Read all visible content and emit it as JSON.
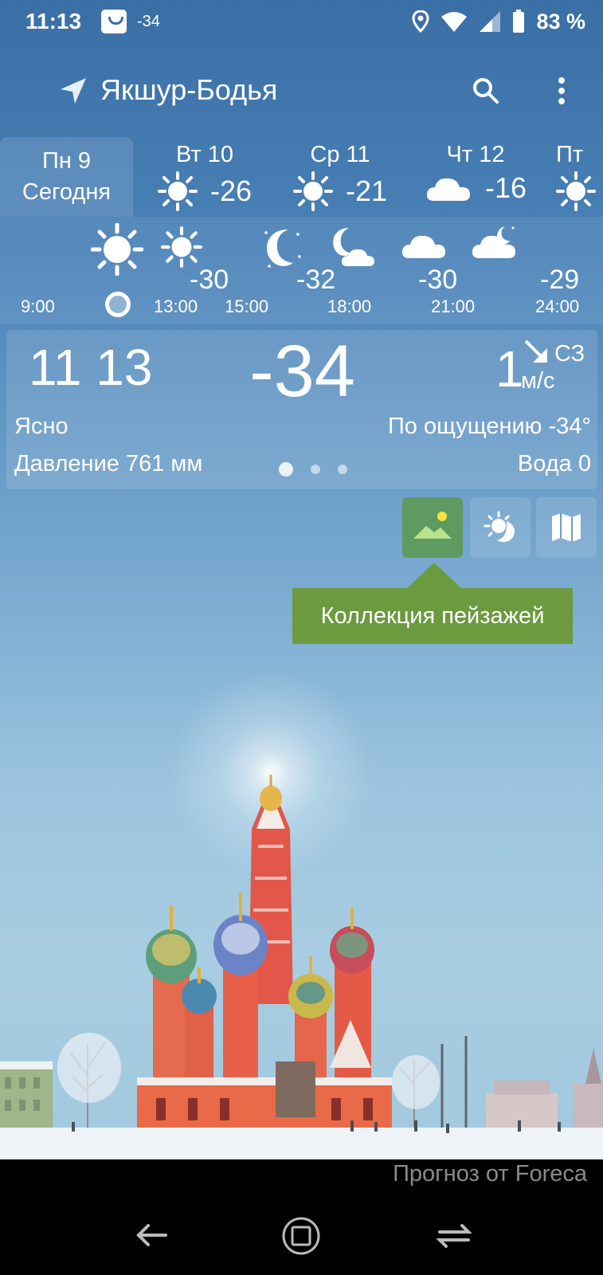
{
  "status_bar": {
    "time": "11:13",
    "notif_temp": "-34",
    "battery_text": "83 %"
  },
  "header": {
    "city": "Якшур-Бодья"
  },
  "days": [
    {
      "name": "Пн 9",
      "label": "Сегодня",
      "selected": true
    },
    {
      "name": "Вт 10",
      "temp": "-26",
      "icon": "sun-icon"
    },
    {
      "name": "Ср 11",
      "temp": "-21",
      "icon": "sun-icon"
    },
    {
      "name": "Чт 12",
      "temp": "-16",
      "icon": "cloud-icon"
    },
    {
      "name": "Пт",
      "icon": "sun-icon"
    }
  ],
  "hourly": {
    "icons": [
      "sun-icon",
      "sun-icon",
      "moon-icon",
      "moon-cloud-icon",
      "cloud-icon",
      "moon-cloud-icon"
    ],
    "temps": [
      "-30",
      "-32",
      "-30",
      "-29"
    ],
    "times": [
      "9:00",
      "13:00",
      "15:00",
      "18:00",
      "21:00",
      "24:00"
    ]
  },
  "current": {
    "time": "11 13",
    "temp": "-34",
    "wind_speed": "1",
    "wind_dir": "СЗ",
    "wind_unit": "м/с",
    "condition": "Ясно",
    "feels_like": "По ощущению -34°",
    "pressure": "Давление 761 мм",
    "water": "Вода 0"
  },
  "view_buttons": [
    "landscape-icon",
    "sun-moon-icon",
    "map-icon"
  ],
  "tooltip": "Коллекция пейзажей",
  "credit": "Прогноз от Foreca",
  "colors": {
    "tooltip_bg": "#6b9a3f",
    "selected_button": "#5f9a60"
  }
}
